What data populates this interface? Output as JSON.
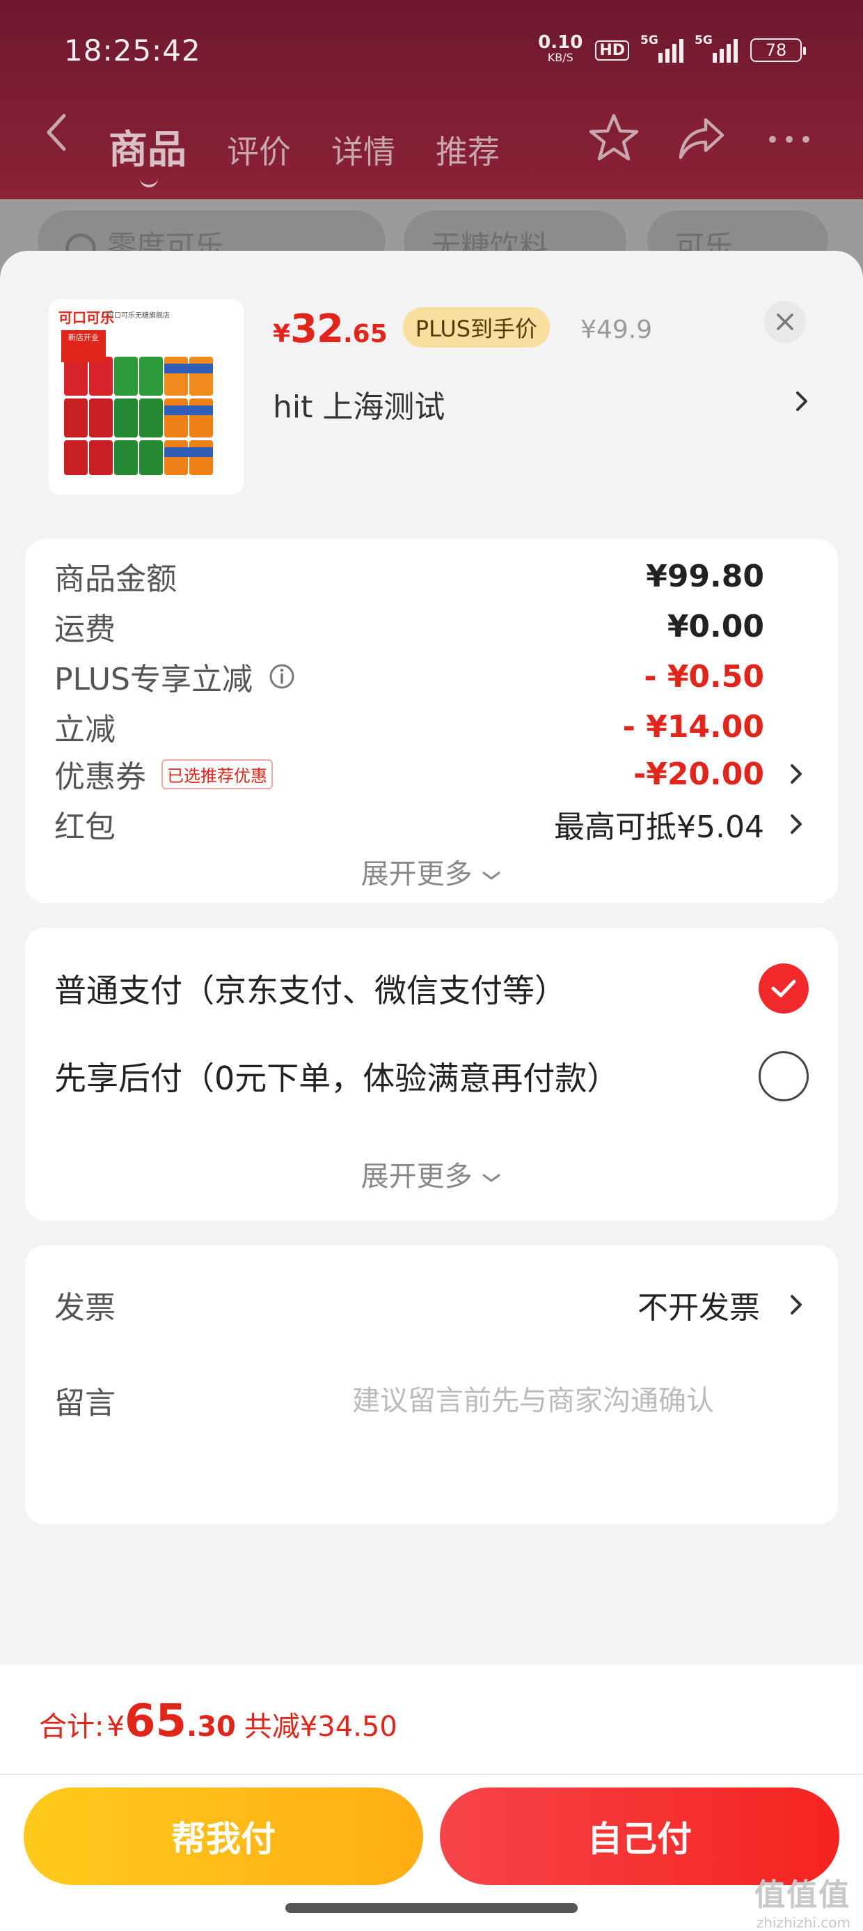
{
  "status_bar": {
    "time": "18:25:42",
    "net_speed": "0.10",
    "net_unit": "KB/S",
    "hd": "HD",
    "sim1": "5G",
    "sim2": "5G",
    "battery": "78"
  },
  "nav": {
    "tabs": [
      {
        "label": "商品",
        "active": true
      },
      {
        "label": "评价",
        "active": false
      },
      {
        "label": "详情",
        "active": false
      },
      {
        "label": "推荐",
        "active": false
      }
    ],
    "icons": [
      "back-icon",
      "star-icon",
      "share-icon",
      "more-icon"
    ]
  },
  "search_chips": [
    "零度可乐",
    "无糖饮料",
    "可乐"
  ],
  "product": {
    "image_brand": "可口可乐",
    "image_store": "可口可乐无糖旗舰店",
    "image_tag": "新店开业",
    "price_symbol": "¥",
    "price_int": "32",
    "price_dec": ".65",
    "plus_badge": "PLUS到手价",
    "original_price": "¥49.9",
    "address": "hit  上海测试"
  },
  "summary": {
    "rows": [
      {
        "label": "商品金额",
        "value": "¥99.80"
      },
      {
        "label": "运费",
        "value": "¥0.00"
      },
      {
        "label": "PLUS专享立减",
        "value": "- ¥0.50"
      },
      {
        "label": "立减",
        "value": "- ¥14.00"
      },
      {
        "label": "优惠券",
        "badge": "已选推荐优惠",
        "value": "-¥20.00"
      },
      {
        "label": "红包",
        "value": "最高可抵¥5.04"
      }
    ],
    "expand_label": "展开更多"
  },
  "payment": {
    "options": [
      {
        "label": "普通支付（京东支付、微信支付等）",
        "selected": true
      },
      {
        "label": "先享后付（0元下单，体验满意再付款）",
        "selected": false
      }
    ],
    "expand_label": "展开更多"
  },
  "invoice": {
    "label": "发票",
    "value": "不开发票",
    "next_label": "留言",
    "next_placeholder": "建议留言前先与商家沟通确认"
  },
  "footer": {
    "total_label": "合计: ",
    "total_symbol": "¥",
    "total_int": "65",
    "total_dec": ".30",
    "saved": "共减¥34.50",
    "btn_help": "帮我付",
    "btn_self": "自己付"
  },
  "watermark": {
    "main": "值值值",
    "sub": "zhizhizhi.com"
  },
  "colors": {
    "accent_red": "#e1251b",
    "button_yellow": "#ffb914",
    "button_red": "#f5231f",
    "plus_gold": "#f8dfa0"
  }
}
